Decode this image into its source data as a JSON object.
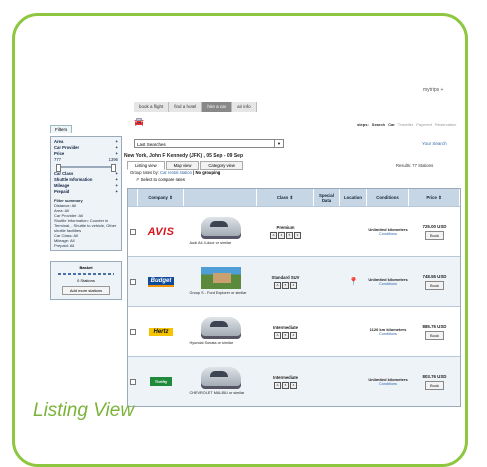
{
  "caption": "Listing View",
  "header": {
    "mytrips": "mytrips +"
  },
  "tabs": [
    {
      "label": "book a flight",
      "active": false
    },
    {
      "label": "find a hotel",
      "active": false
    },
    {
      "label": "hire a car",
      "active": true
    },
    {
      "label": "air info",
      "active": false
    }
  ],
  "steps": {
    "label": "steps:",
    "items": [
      "Search",
      "Car",
      "Traveller",
      "Payment",
      "Reservation"
    ],
    "current": 1
  },
  "last_searches": {
    "value": "Last Searches",
    "dropdown_icon": "chevron-down-icon"
  },
  "your_search": "Your Search",
  "route": "New York, John F Kennedy (JFK) , 05 Sep - 09 Sep",
  "view_tabs": [
    {
      "label": "Listing view",
      "active": true
    },
    {
      "label": "Map view",
      "active": false
    },
    {
      "label": "Category view",
      "active": false
    }
  ],
  "results": "Results: 77 Stations",
  "group_by": {
    "prefix": "Group rates by:",
    "link": "Car rental station",
    "rest": "| No grouping"
  },
  "select_compare": "Select to compare rates",
  "sidebar": {
    "tab": "Filters",
    "filters": [
      {
        "label": "Area",
        "sign": "+"
      },
      {
        "label": "Car Provider",
        "sign": "+"
      },
      {
        "label": "Price",
        "sign": "+"
      }
    ],
    "price_range": {
      "min": "777",
      "max": "1396"
    },
    "filters2": [
      {
        "label": "Car Class",
        "sign": "+"
      },
      {
        "label": "Shuttle Information",
        "sign": "+"
      },
      {
        "label": "Mileage",
        "sign": "+"
      },
      {
        "label": "Prepaid",
        "sign": "+"
      }
    ],
    "summary_title": "Filter summary",
    "summary": [
      "Distance: All",
      "Area: All",
      "Car Provider: All",
      "Shuttle Information: Counter in Terminal, , Shuttle to vehicle, Other shuttle facilities",
      "Car Class: All",
      "Mileage: All",
      "Prepaid: All"
    ],
    "basket": {
      "title": "Basket",
      "count": "0 Stations",
      "button": "Add more stations"
    }
  },
  "table": {
    "headers": [
      "Company",
      "Class",
      "Special Data",
      "Location",
      "Conditions",
      "Price"
    ],
    "rows": [
      {
        "company": "AVIS",
        "logo": "avis",
        "car_name": "Audi A4 4-door or similar",
        "class": "Premium",
        "features": [
          "A",
          "4",
          "5",
          "2"
        ],
        "location_icon": "",
        "conditions": "Unlimited kilometers",
        "conditions_link": "Conditions",
        "price": "725.00 USD",
        "book": "Book",
        "image": "car"
      },
      {
        "company": "Budget",
        "logo": "budget",
        "car_name": "Group S - Ford Explorer or similar",
        "class": "Standard SUV",
        "features": [
          "A",
          "5",
          "4"
        ],
        "location_icon": "map-pin-icon",
        "conditions": "Unlimited kilometers",
        "conditions_link": "Conditions",
        "price": "748.55 USD",
        "book": "Book",
        "image": "photo"
      },
      {
        "company": "Hertz",
        "logo": "hertz",
        "car_name": "Hyundai Sonata or similar",
        "class": "Intermediate",
        "features": [
          "A",
          "5",
          "4"
        ],
        "location_icon": "",
        "conditions": "1126 km kilometers",
        "conditions_link": "Conditions",
        "price": "885.75 USD",
        "book": "Book",
        "image": "car"
      },
      {
        "company": "Thrifty",
        "logo": "thrifty",
        "car_name": "CHEVROLET MALIBU or similar",
        "class": "Intermediate",
        "features": [
          "A",
          "5",
          "4"
        ],
        "location_icon": "",
        "conditions": "Unlimited kilometers",
        "conditions_link": "Conditions",
        "price": "803.76 USD",
        "book": "Book",
        "image": "car"
      }
    ]
  }
}
